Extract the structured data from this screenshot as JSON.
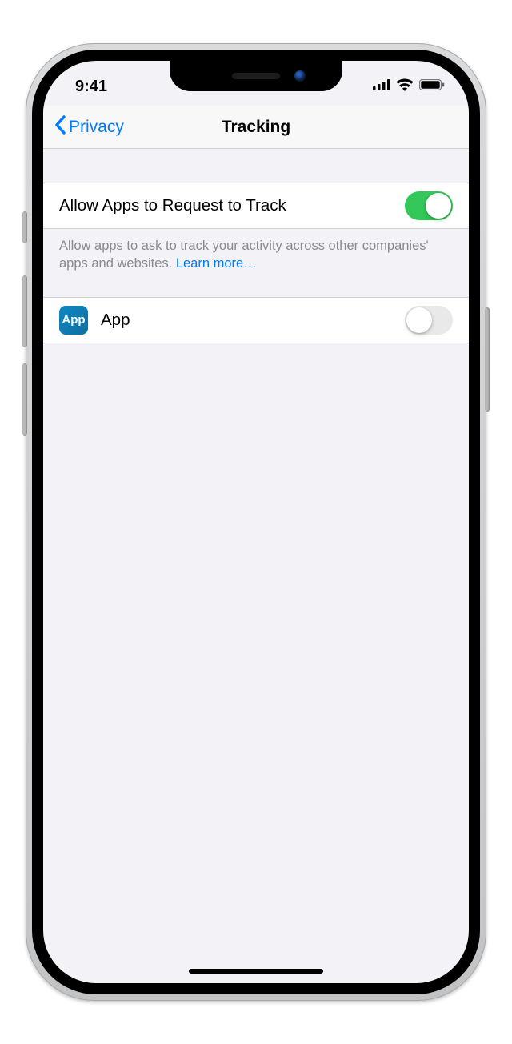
{
  "status": {
    "time": "9:41"
  },
  "nav": {
    "back_label": "Privacy",
    "title": "Tracking"
  },
  "main": {
    "allow_label": "Allow Apps to Request to Track",
    "allow_on": true,
    "footer_text": "Allow apps to ask to track your activity across other companies' apps and websites. ",
    "learn_more": "Learn more…"
  },
  "apps": [
    {
      "icon_label": "App",
      "name": "App",
      "on": false
    }
  ]
}
